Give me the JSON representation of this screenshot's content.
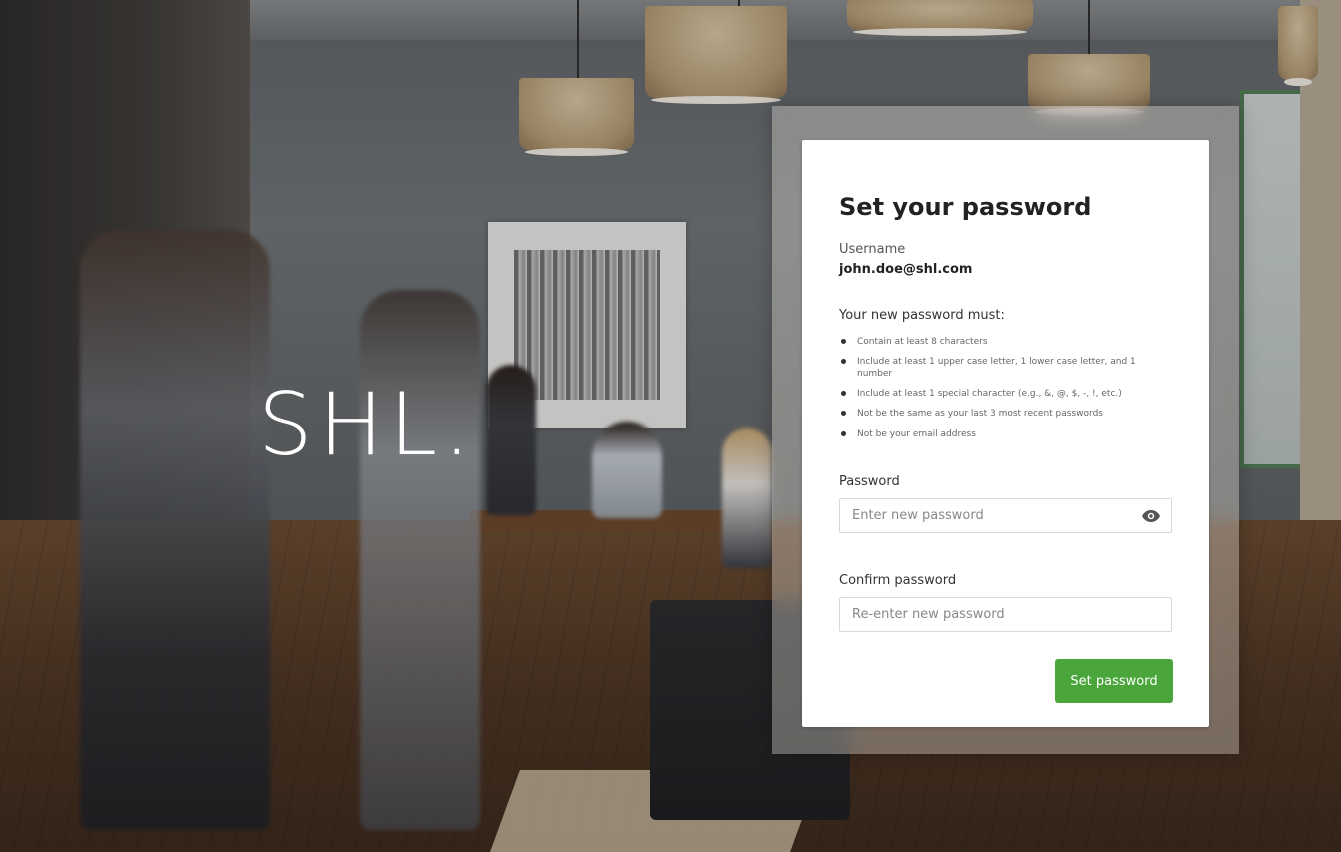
{
  "brand": {
    "logo_text": "SHL."
  },
  "card": {
    "title": "Set your password",
    "username_label": "Username",
    "username_value": "john.doe@shl.com",
    "rules_heading": "Your new password must:",
    "rules": [
      "Contain at least 8 characters",
      "Include at least 1 upper case letter, 1 lower case letter, and 1 number",
      "Include at least 1 special character (e.g., &, @, $, -, !, etc.)",
      "Not be the same as your last 3 most recent passwords",
      "Not be your email address"
    ],
    "password_label": "Password",
    "password_placeholder": "Enter new password",
    "confirm_label": "Confirm password",
    "confirm_placeholder": "Re-enter new password",
    "submit_label": "Set password"
  },
  "icons": {
    "show_password": "eye-icon"
  },
  "colors": {
    "primary_button": "#4aa63a",
    "card_background": "#ffffff"
  }
}
